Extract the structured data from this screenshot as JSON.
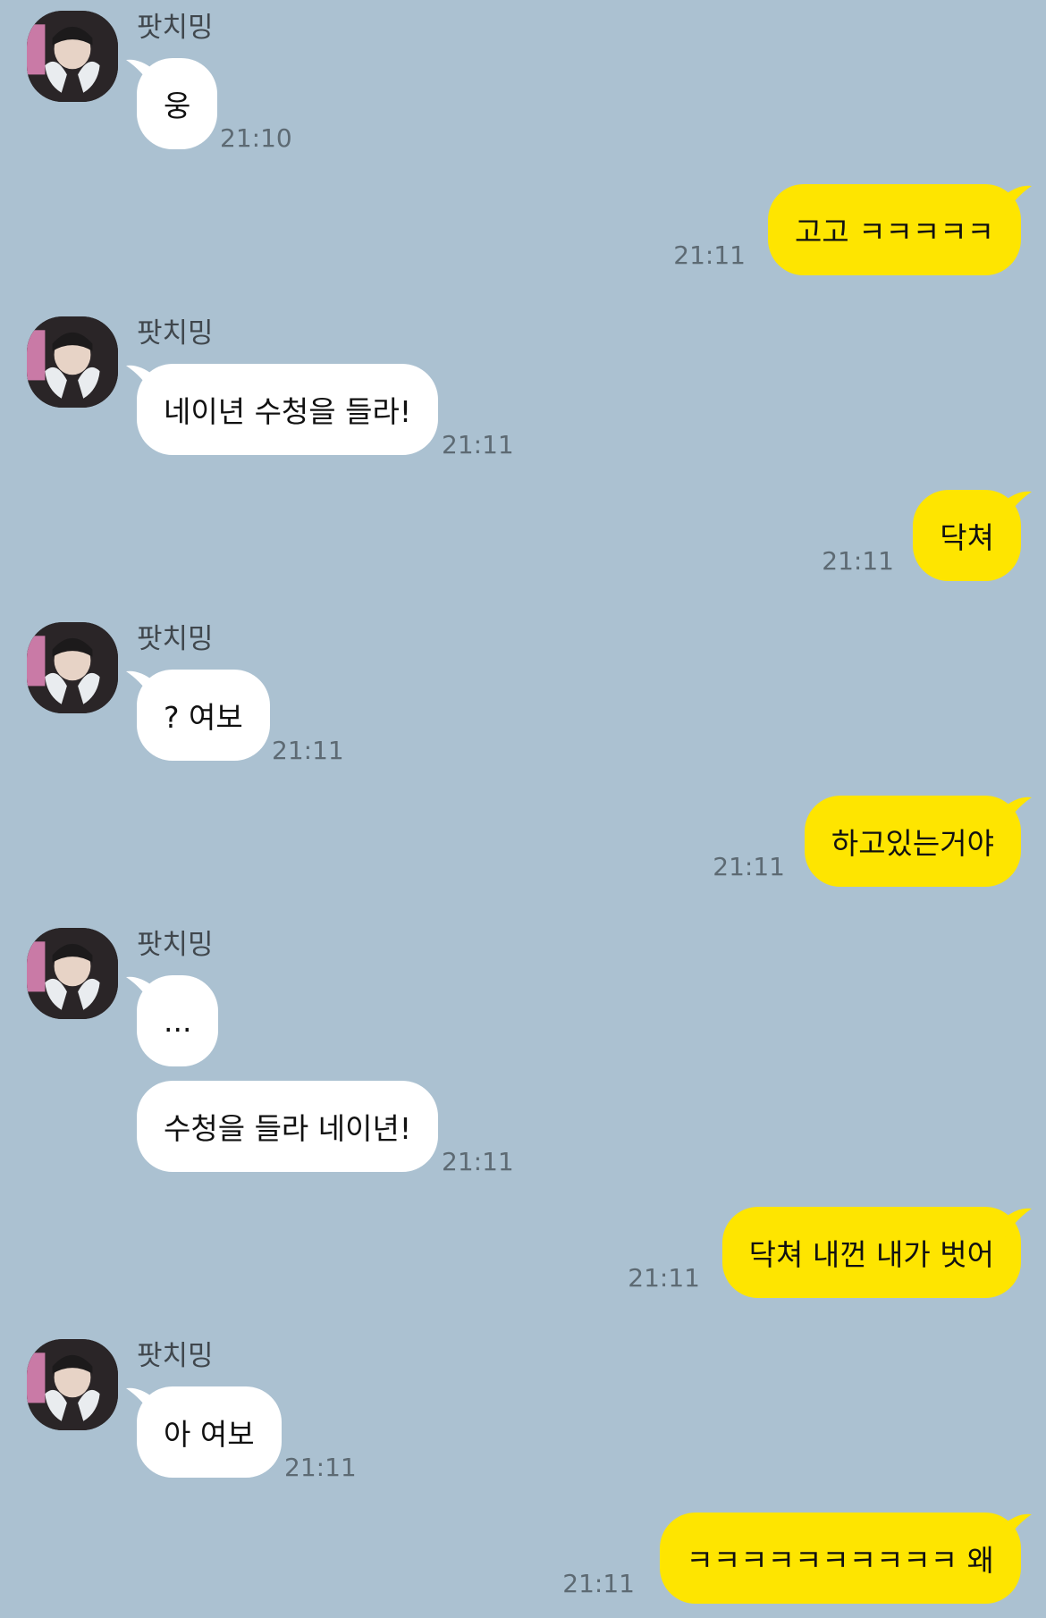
{
  "sender_name": "팟치밍",
  "colors": {
    "background": "#abc1d1",
    "incoming_bubble": "#ffffff",
    "outgoing_bubble": "#fee500"
  },
  "messages": [
    {
      "side": "in",
      "text": "웅",
      "time": "21:10"
    },
    {
      "side": "out",
      "text": "고고 ㅋㅋㅋㅋㅋ",
      "time": "21:11"
    },
    {
      "side": "in",
      "text": "네이년 수청을 들라!",
      "time": "21:11"
    },
    {
      "side": "out",
      "text": "닥쳐",
      "time": "21:11"
    },
    {
      "side": "in",
      "text": "? 여보",
      "time": "21:11"
    },
    {
      "side": "out",
      "text": "하고있는거야",
      "time": "21:11"
    },
    {
      "side": "in",
      "text": "...",
      "time": ""
    },
    {
      "side": "in",
      "text": "수청을 들라 네이년!",
      "time": "21:11"
    },
    {
      "side": "out",
      "text": "닥쳐 내껀 내가 벗어",
      "time": "21:11"
    },
    {
      "side": "in",
      "text": "아 여보",
      "time": "21:11"
    },
    {
      "side": "out",
      "text": "ㅋㅋㅋㅋㅋㅋㅋㅋㅋㅋ 왜",
      "time": "21:11"
    }
  ]
}
